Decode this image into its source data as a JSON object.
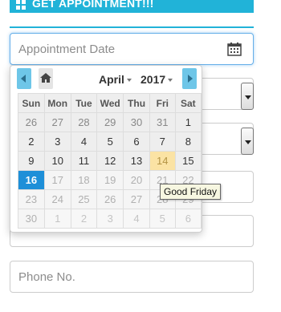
{
  "header": {
    "appointment_button_label": "GET APPOINTMENT!!!"
  },
  "form": {
    "appointment_date_placeholder": "Appointment Date",
    "phone_placeholder": "Phone No."
  },
  "datepicker": {
    "month_label": "April",
    "year_label": "2017",
    "weekdays": [
      "Sun",
      "Mon",
      "Tue",
      "Wed",
      "Thu",
      "Fri",
      "Sat"
    ],
    "weeks": [
      [
        "26",
        "27",
        "28",
        "29",
        "30",
        "31",
        "1"
      ],
      [
        "2",
        "3",
        "4",
        "5",
        "6",
        "7",
        "8"
      ],
      [
        "9",
        "10",
        "11",
        "12",
        "13",
        "14",
        "15"
      ],
      [
        "16",
        "17",
        "18",
        "19",
        "20",
        "21",
        "22"
      ],
      [
        "23",
        "24",
        "25",
        "26",
        "27",
        "28",
        "29"
      ],
      [
        "30",
        "1",
        "2",
        "3",
        "4",
        "5",
        "6"
      ]
    ],
    "selected_day": "16",
    "holiday_day": "14",
    "holiday_tooltip": "Good Friday"
  },
  "colors": {
    "accent": "#21b3d8",
    "selected": "#1e8fd8",
    "holiday": "#fbe3a4"
  },
  "icons": [
    "grid-icon",
    "calendar-icon",
    "prev-arrow-icon",
    "home-icon",
    "next-arrow-icon",
    "dropdown-arrow-icon"
  ]
}
